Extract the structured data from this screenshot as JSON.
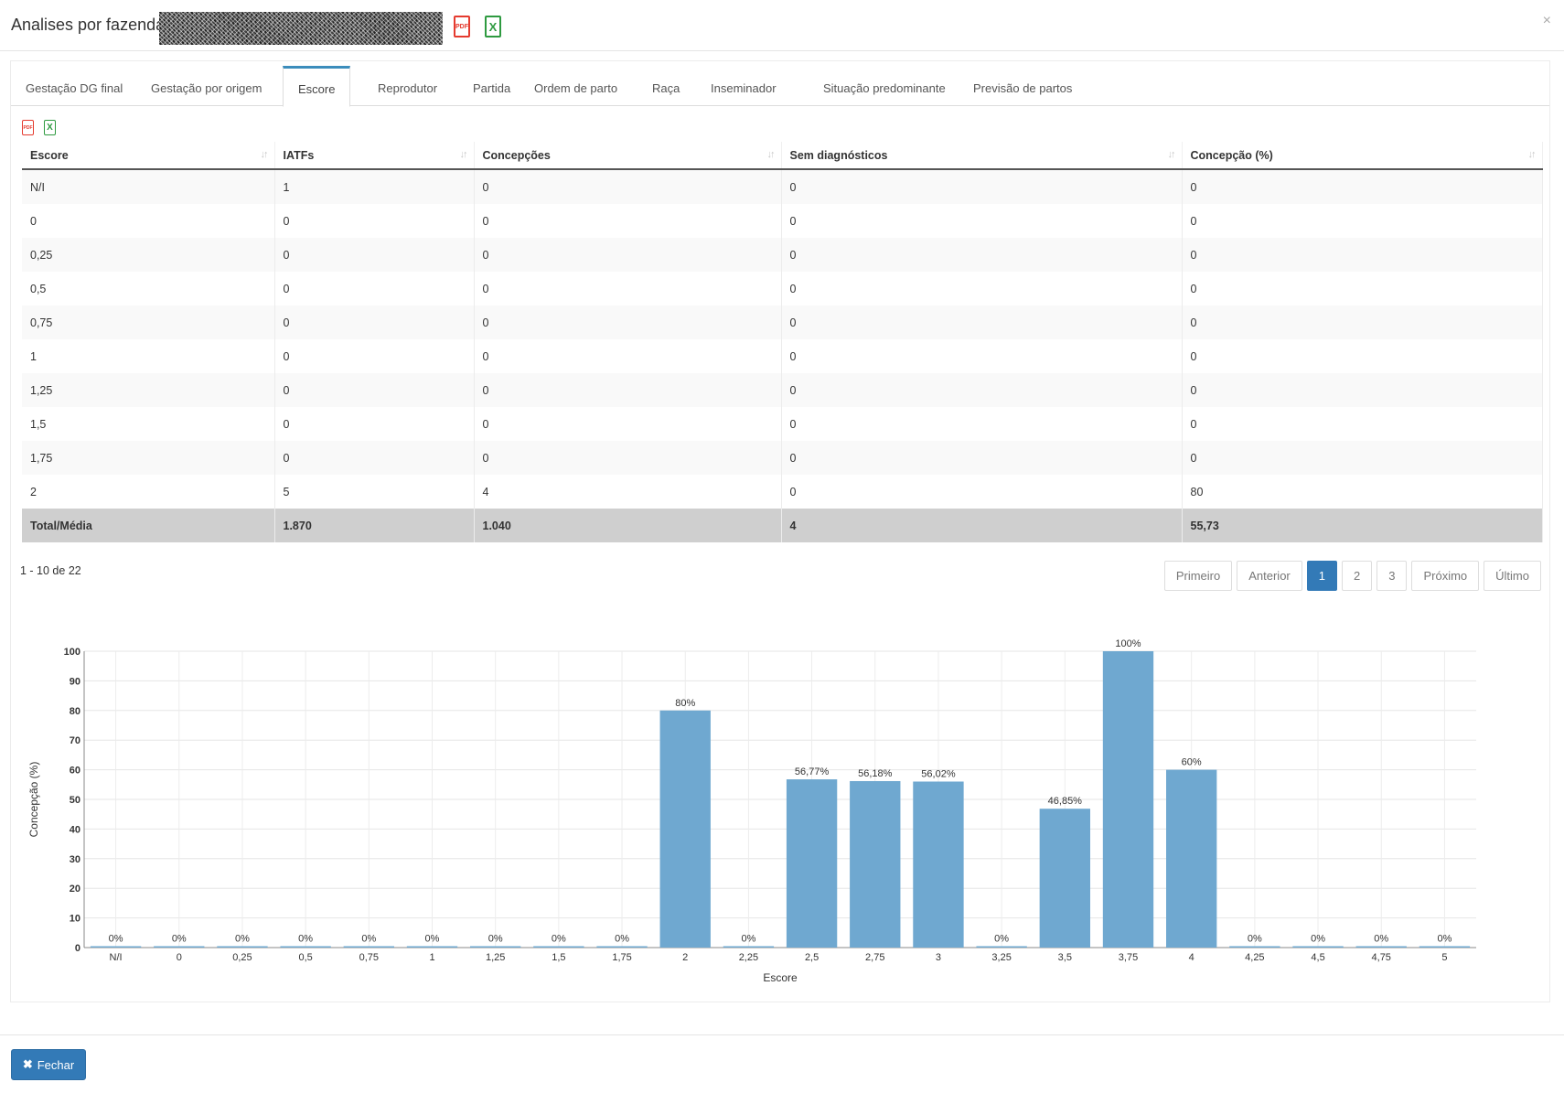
{
  "header": {
    "title": "Analises por fazendas",
    "pdf_icon": "pdf-file-icon",
    "excel_icon": "excel-file-icon",
    "close_symbol": "×"
  },
  "tabs": [
    {
      "label": "Gestação DG final",
      "active": false
    },
    {
      "label": "Gestação por origem",
      "active": false
    },
    {
      "label": "Escore",
      "active": true
    },
    {
      "label": "Reprodutor",
      "active": false
    },
    {
      "label": "Partida",
      "active": false
    },
    {
      "label": "Ordem de parto",
      "active": false
    },
    {
      "label": "Raça",
      "active": false
    },
    {
      "label": "Inseminador",
      "active": false
    },
    {
      "label": "Situação predominante",
      "active": false
    },
    {
      "label": "Previsão de partos",
      "active": false
    }
  ],
  "table": {
    "columns": [
      "Escore",
      "IATFs",
      "Concepções",
      "Sem diagnósticos",
      "Concepção (%)"
    ],
    "rows": [
      [
        "N/I",
        "1",
        "0",
        "0",
        "0"
      ],
      [
        "0",
        "0",
        "0",
        "0",
        "0"
      ],
      [
        "0,25",
        "0",
        "0",
        "0",
        "0"
      ],
      [
        "0,5",
        "0",
        "0",
        "0",
        "0"
      ],
      [
        "0,75",
        "0",
        "0",
        "0",
        "0"
      ],
      [
        "1",
        "0",
        "0",
        "0",
        "0"
      ],
      [
        "1,25",
        "0",
        "0",
        "0",
        "0"
      ],
      [
        "1,5",
        "0",
        "0",
        "0",
        "0"
      ],
      [
        "1,75",
        "0",
        "0",
        "0",
        "0"
      ],
      [
        "2",
        "5",
        "4",
        "0",
        "80"
      ]
    ],
    "total": [
      "Total/Média",
      "1.870",
      "1.040",
      "4",
      "55,73"
    ]
  },
  "pagination": {
    "info": "1 - 10 de 22",
    "first": "Primeiro",
    "prev": "Anterior",
    "pages": [
      "1",
      "2",
      "3"
    ],
    "current": "1",
    "next": "Próximo",
    "last": "Último"
  },
  "footer": {
    "close_label": "Fechar",
    "close_icon": "times-icon",
    "primary_color": "#337ab7"
  },
  "chart_data": {
    "type": "bar",
    "categories": [
      "N/I",
      "0",
      "0,25",
      "0,5",
      "0,75",
      "1",
      "1,25",
      "1,5",
      "1,75",
      "2",
      "2,25",
      "2,5",
      "2,75",
      "3",
      "3,25",
      "3,5",
      "3,75",
      "4",
      "4,25",
      "4,5",
      "4,75",
      "5"
    ],
    "values": [
      0,
      0,
      0,
      0,
      0,
      0,
      0,
      0,
      0,
      80,
      0,
      56.77,
      56.18,
      56.02,
      0,
      46.85,
      100,
      60,
      0,
      0,
      0,
      0
    ],
    "data_labels": [
      "0%",
      "0%",
      "0%",
      "0%",
      "0%",
      "0%",
      "0%",
      "0%",
      "0%",
      "80%",
      "0%",
      "56,77%",
      "56,18%",
      "56,02%",
      "0%",
      "46,85%",
      "100%",
      "60%",
      "0%",
      "0%",
      "0%",
      "0%"
    ],
    "xlabel": "Escore",
    "ylabel": "Concepção (%)",
    "ylim": [
      0,
      100
    ],
    "yticks": [
      0,
      10,
      20,
      30,
      40,
      50,
      60,
      70,
      80,
      90,
      100
    ],
    "grid": true,
    "bar_color": "#6fa8d0"
  }
}
